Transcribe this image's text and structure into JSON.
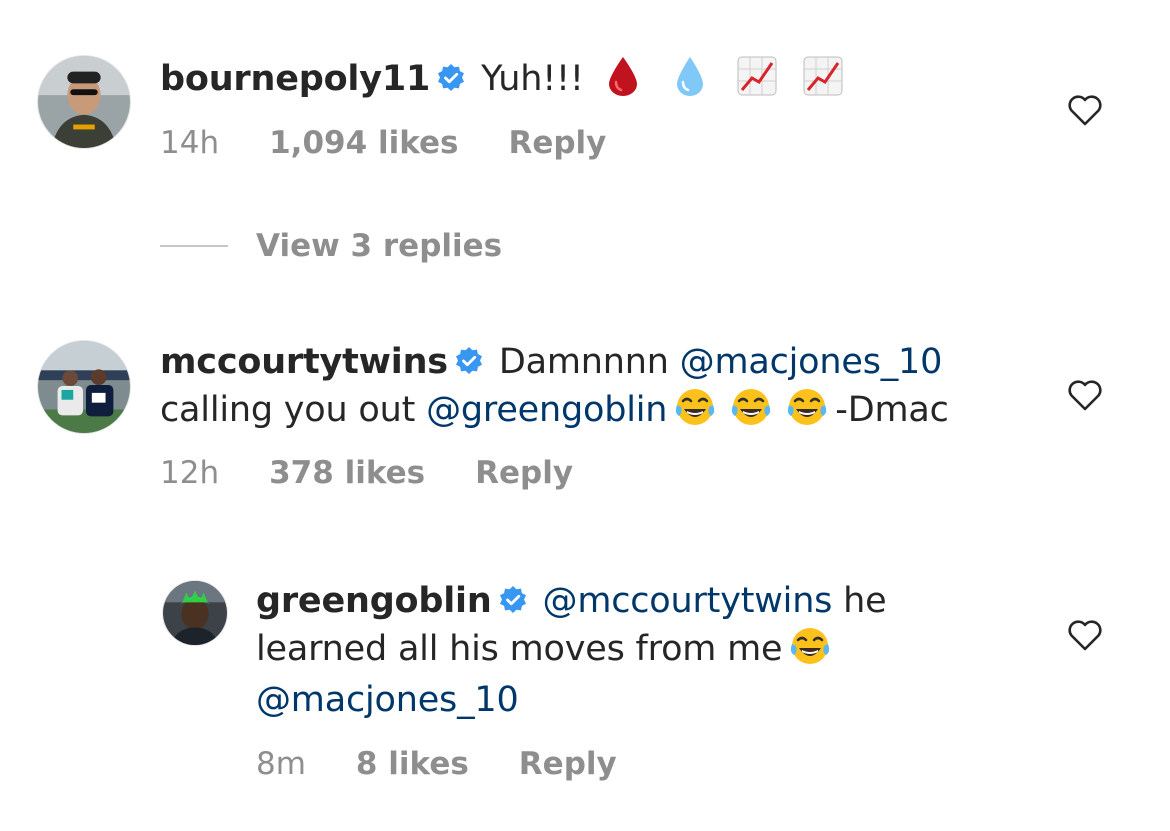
{
  "comments": [
    {
      "username": "bournepoly11",
      "text": "Yuh!!!",
      "time": "14h",
      "likes": "1,094 likes",
      "reply": "Reply",
      "emoji": [
        "drop-of-blood",
        "droplet",
        "chart-increasing",
        "chart-increasing"
      ]
    },
    {
      "username": "mccourtytwins",
      "text_1": "Damnnnn",
      "mention_1": "@macjones_10",
      "text_2": "calling you out",
      "mention_2": "@greengoblin",
      "text_3": "-Dmac",
      "time": "12h",
      "likes": "378 likes",
      "reply": "Reply",
      "emoji": [
        "face-with-tears-of-joy",
        "face-with-tears-of-joy",
        "face-with-tears-of-joy"
      ]
    },
    {
      "username": "greengoblin",
      "mention_1": "@mccourtytwins",
      "text_1": "he",
      "text_2": "learned all his moves from me",
      "mention_2": "@macjones_10",
      "time": "8m",
      "likes": "8 likes",
      "reply": "Reply",
      "emoji": [
        "face-with-tears-of-joy"
      ]
    }
  ],
  "view_replies": "View 3 replies",
  "colors": {
    "text": "#262626",
    "meta": "#8e8e8e",
    "mention": "#00376b",
    "verified": "#3897f0"
  }
}
